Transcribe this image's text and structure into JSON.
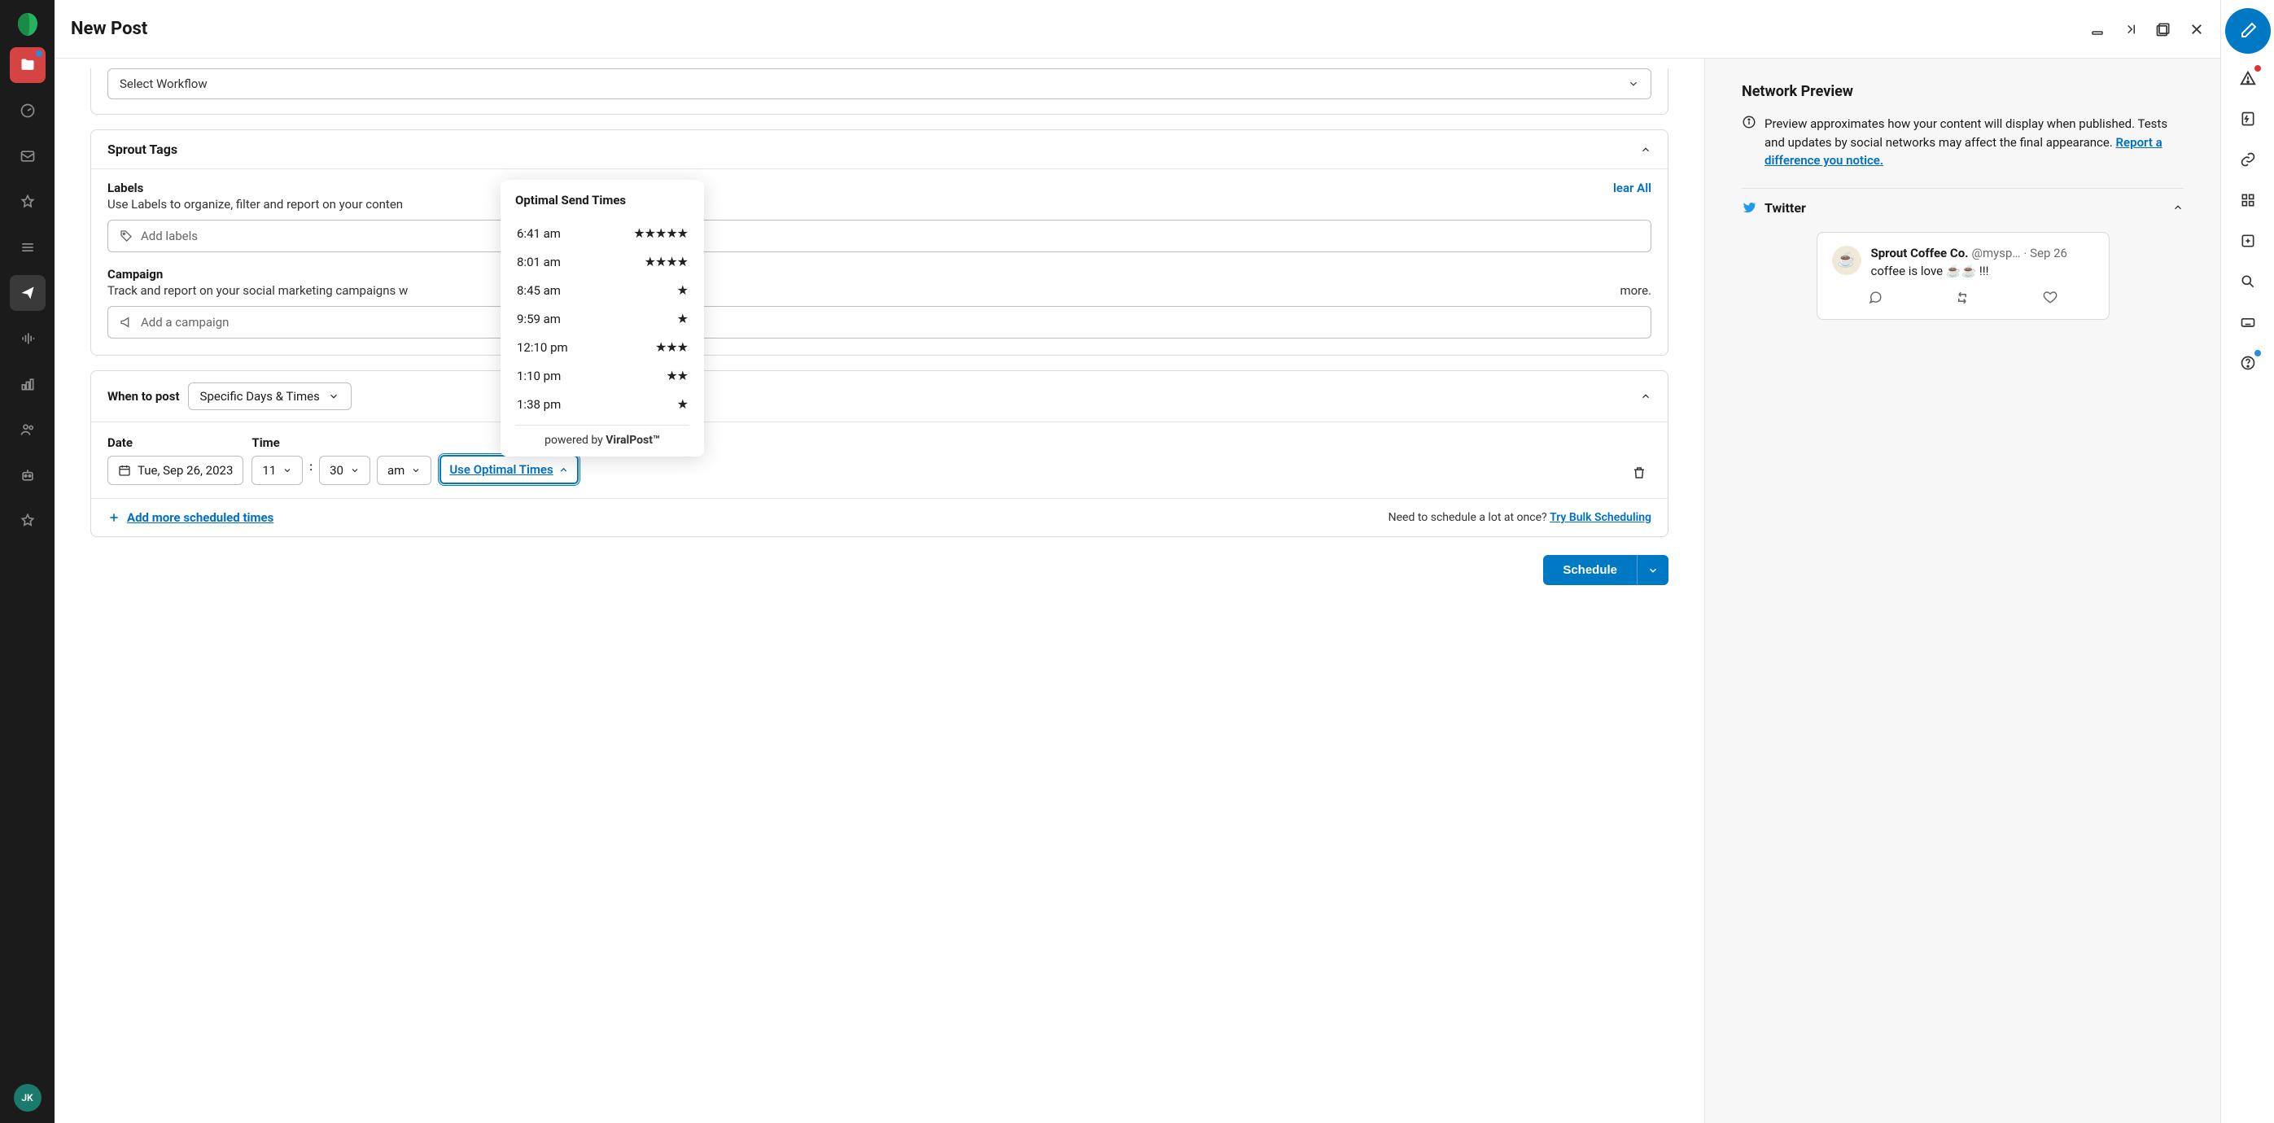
{
  "header": {
    "title": "New Post"
  },
  "leftNav": {
    "avatar": "JK"
  },
  "workflow": {
    "placeholder": "Select Workflow"
  },
  "tags": {
    "section_title": "Sprout Tags",
    "labels_title": "Labels",
    "labels_desc": "Use Labels to organize, filter and report on your conten",
    "labels_clear": "lear All",
    "labels_placeholder": "Add labels",
    "campaign_title": "Campaign",
    "campaign_desc": "Track and report on your social marketing campaigns w",
    "campaign_more": "more.",
    "campaign_placeholder": "Add a campaign"
  },
  "when": {
    "label": "When to post",
    "mode": "Specific Days & Times",
    "date_label": "Date",
    "date_value": "Tue, Sep 26, 2023",
    "time_label": "Time",
    "hour": "11",
    "minute": "30",
    "ampm": "am",
    "optimal_btn": "Use Optimal Times",
    "add_more": "Add more scheduled times",
    "bulk_prompt": "Need to schedule a lot at once?",
    "bulk_link": "Try Bulk Scheduling"
  },
  "optimal": {
    "title": "Optimal Send Times",
    "times": [
      {
        "time": "6:41 am",
        "stars": 5
      },
      {
        "time": "8:01 am",
        "stars": 4
      },
      {
        "time": "8:45 am",
        "stars": 1
      },
      {
        "time": "9:59 am",
        "stars": 1
      },
      {
        "time": "12:10 pm",
        "stars": 3
      },
      {
        "time": "1:10 pm",
        "stars": 2
      },
      {
        "time": "1:38 pm",
        "stars": 1
      }
    ],
    "footer_prefix": "powered by ",
    "footer_brand": "ViralPost™"
  },
  "schedule_btn": "Schedule",
  "preview": {
    "title": "Network Preview",
    "note": "Preview approximates how your content will display when published. Tests and updates by social networks may affect the final appearance. ",
    "report_link": "Report a difference you notice.",
    "network": "Twitter",
    "tweet": {
      "name": "Sprout Coffee Co.",
      "handle": "@mysp…",
      "date": "Sep 26",
      "text": "coffee is love ☕☕ !!!"
    }
  }
}
